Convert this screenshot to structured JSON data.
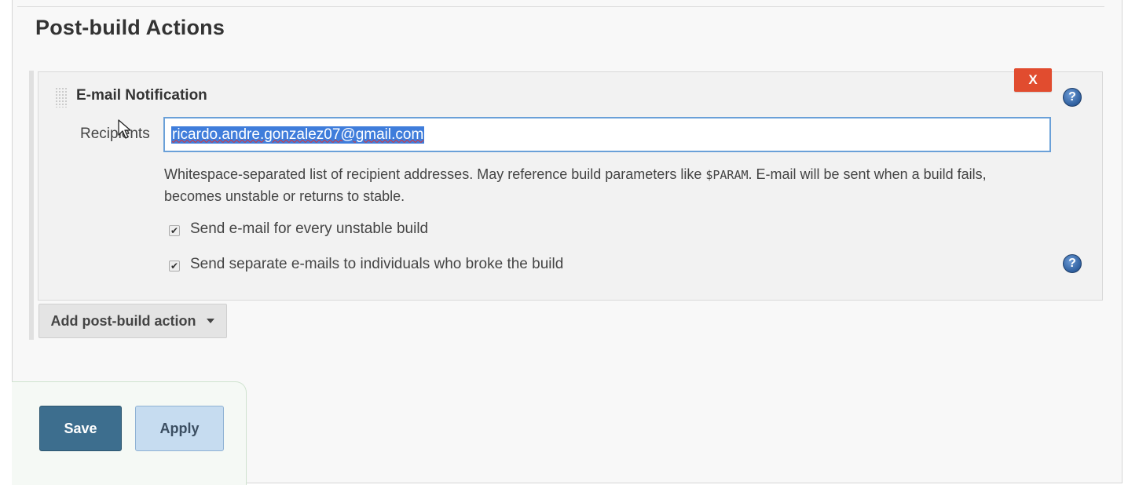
{
  "section": {
    "title": "Post-build Actions"
  },
  "email_notification": {
    "title": "E-mail Notification",
    "delete_label": "X",
    "help_label": "?",
    "recipients_label": "Recipients",
    "recipients_value": "ricardo.andre.gonzalez07@gmail.com",
    "description_prefix": "Whitespace-separated list of recipient addresses. May reference build parameters like ",
    "description_param": "$PARAM",
    "description_suffix": ". E-mail will be sent when a build fails, becomes unstable or returns to stable.",
    "options": [
      {
        "label": "Send e-mail for every unstable build",
        "checked": true
      },
      {
        "label": "Send separate e-mails to individuals who broke the build",
        "checked": true
      }
    ]
  },
  "add_action": {
    "label": "Add post-build action"
  },
  "footer": {
    "save_label": "Save",
    "apply_label": "Apply"
  },
  "colors": {
    "delete_button": "#e14c2f",
    "save_button": "#3d6e8e",
    "apply_button": "#c6dcf0",
    "selection_highlight": "#3f7ddb",
    "help_icon": "#2f5f9e"
  },
  "icons": {
    "delete": "close-icon",
    "help": "help-icon",
    "checkbox": "checkmark-icon",
    "dropdown": "caret-down-icon",
    "drag": "drag-handle-icon",
    "pointer": "mouse-cursor-icon"
  }
}
